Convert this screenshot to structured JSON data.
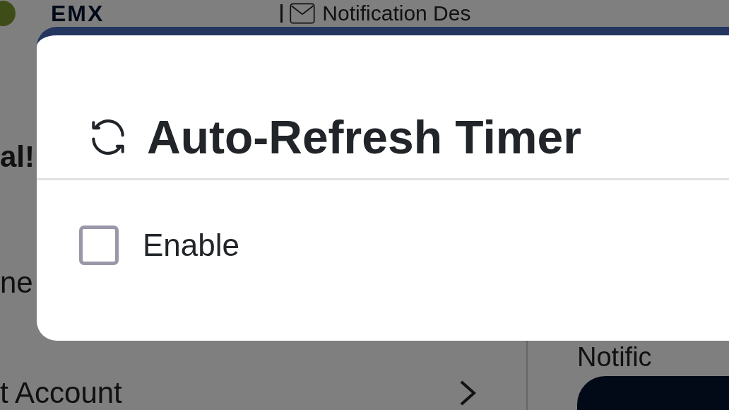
{
  "background": {
    "logo": "EMX",
    "header_title": "Notification Des",
    "left_items": [
      {
        "text": "al!",
        "kind": "heading"
      },
      {
        "text": "ne",
        "kind": "item"
      },
      {
        "text": "t Account",
        "kind": "link"
      }
    ],
    "right_heading": "Notific"
  },
  "modal": {
    "title": "Auto-Refresh Timer",
    "options": [
      {
        "label": "Enable",
        "checked": false
      }
    ]
  }
}
